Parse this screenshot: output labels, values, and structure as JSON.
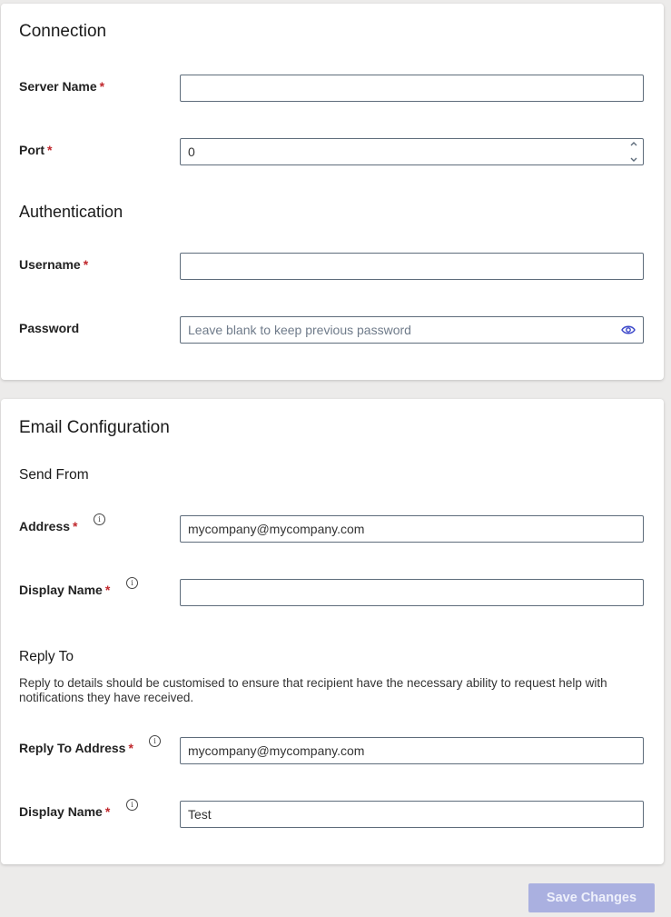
{
  "connection": {
    "title": "Connection",
    "server_name": {
      "label": "Server Name",
      "required": "*",
      "value": ""
    },
    "port": {
      "label": "Port",
      "required": "*",
      "value": "0"
    }
  },
  "authentication": {
    "title": "Authentication",
    "username": {
      "label": "Username",
      "required": "*",
      "value": ""
    },
    "password": {
      "label": "Password",
      "value": "",
      "placeholder": "Leave blank to keep previous password"
    }
  },
  "email_configuration": {
    "title": "Email Configuration",
    "send_from": {
      "title": "Send From",
      "address": {
        "label": "Address",
        "required": "*",
        "value": "mycompany@mycompany.com"
      },
      "display_name": {
        "label": "Display Name",
        "required": "*",
        "value": ""
      }
    },
    "reply_to": {
      "title": "Reply To",
      "description": "Reply to details should be customised to ensure that recipient have the necessary ability to request help with notifications they have received.",
      "address": {
        "label": "Reply To Address",
        "required": "*",
        "value": "mycompany@mycompany.com"
      },
      "display_name": {
        "label": "Display Name",
        "required": "*",
        "value": "Test"
      }
    }
  },
  "icons": {
    "info": "i"
  },
  "footer": {
    "save_label": "Save Changes"
  },
  "colors": {
    "required": "#c0282d",
    "button_disabled": "#aab0e0",
    "eye_icon": "#3a46c9"
  }
}
